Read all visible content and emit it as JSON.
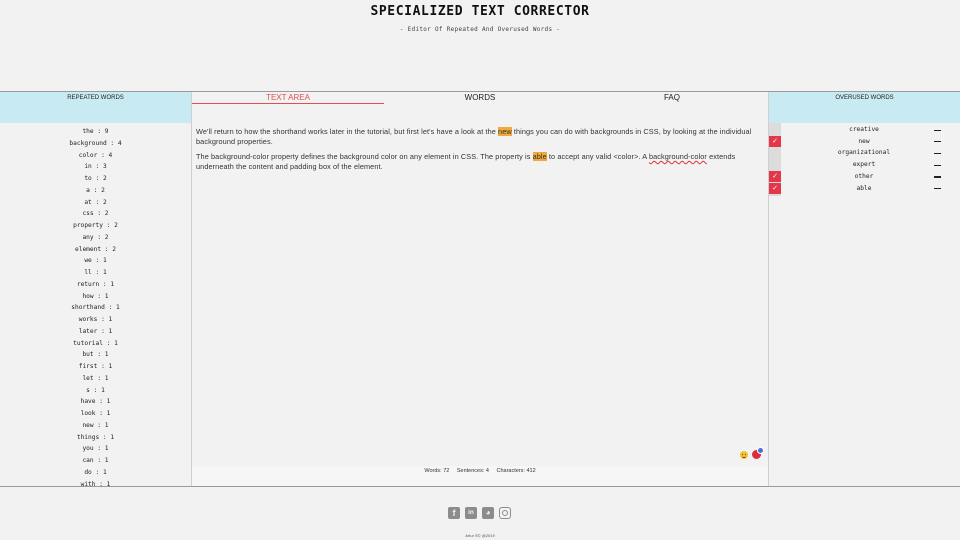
{
  "header": {
    "title": "SPECIALIZED TEXT CORRECTOR",
    "subtitle": "- Editor Of Repeated And Overused Words -"
  },
  "left_panel": {
    "heading": "REPEATED WORDS",
    "items": [
      "the : 9",
      "background : 4",
      "color : 4",
      "in : 3",
      "to : 2",
      "a : 2",
      "at : 2",
      "css : 2",
      "property : 2",
      "any : 2",
      "element : 2",
      "we : 1",
      "ll : 1",
      "return : 1",
      "how : 1",
      "shorthand : 1",
      "works : 1",
      "later : 1",
      "tutorial : 1",
      "but : 1",
      "first : 1",
      "let : 1",
      "s : 1",
      "have : 1",
      "look : 1",
      "new : 1",
      "things : 1",
      "you : 1",
      "can : 1",
      "do : 1",
      "with : 1"
    ]
  },
  "tabs": {
    "text_area": "TEXT AREA",
    "words": "WORDS",
    "faq": "FAQ"
  },
  "editor": {
    "p1_a": "We'll return to how the shorthand works later in the tutorial, but first let's have a look at the ",
    "p1_hl": "new",
    "p1_b": " things you can do with backgrounds in CSS, by looking at the individual background properties.",
    "p2_a": "The background-color property defines the background color on any element in CSS. The property is ",
    "p2_hl": "able",
    "p2_b": " to accept any valid <color>. A ",
    "p2_ul": "background-color",
    "p2_c": " extends underneath the content and padding box of the element."
  },
  "stats": {
    "words": "Words: 72",
    "sentences": "Sentences: 4",
    "characters": "Characters: 412"
  },
  "right_panel": {
    "heading": "OVERUSED WORDS",
    "items": [
      {
        "word": "creative",
        "checked": false
      },
      {
        "word": "new",
        "checked": true
      },
      {
        "word": "organizational",
        "checked": false
      },
      {
        "word": "expert",
        "checked": false
      },
      {
        "word": "other",
        "checked": true
      },
      {
        "word": "able",
        "checked": true
      }
    ],
    "check_glyph": "✓",
    "accent_color": "#e4384a"
  },
  "footer": {
    "icons": [
      "facebook-icon",
      "linkedin-icon",
      "github-icon",
      "instagram-icon"
    ],
    "facebook_glyph": "f",
    "linkedin_glyph": "in",
    "github_glyph": "◕",
    "credit": "Artur Ś© @2019"
  },
  "colors": {
    "panel_head": "#c8ebf3",
    "highlight": "#f2a93b",
    "active_tab": "#e05050"
  }
}
